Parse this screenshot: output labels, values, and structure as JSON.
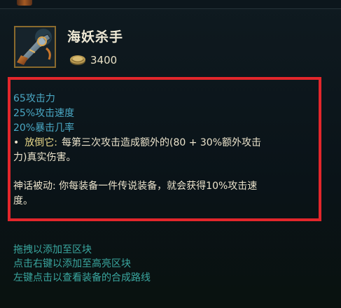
{
  "item": {
    "name": "海妖杀手",
    "icon": "kraken-slayer-icon",
    "gold_icon": "gold-coin-icon",
    "cost": "3400"
  },
  "stats": [
    "65攻击力",
    "25%攻击速度",
    "20%暴击几率"
  ],
  "passive": {
    "bullet": "•",
    "name": "放倒它:",
    "text_line1": "每第三次攻击造成额外的(80 + 30%额外攻击",
    "text_line2": "力)真实伤害。"
  },
  "mythic": {
    "line1": "神话被动: 你每装备一件传说装备，就会获得10%攻击速",
    "line2": "度。"
  },
  "hints": [
    "拖拽以添加至区块",
    "点击右键以添加至高亮区块",
    "左键点击以查看装备的合成路线"
  ],
  "colors": {
    "highlight_border": "#e3262b",
    "stat_blue": "#4aa8c4",
    "hint_teal": "#3aa7a0",
    "passive_gold": "#e9d88a"
  }
}
